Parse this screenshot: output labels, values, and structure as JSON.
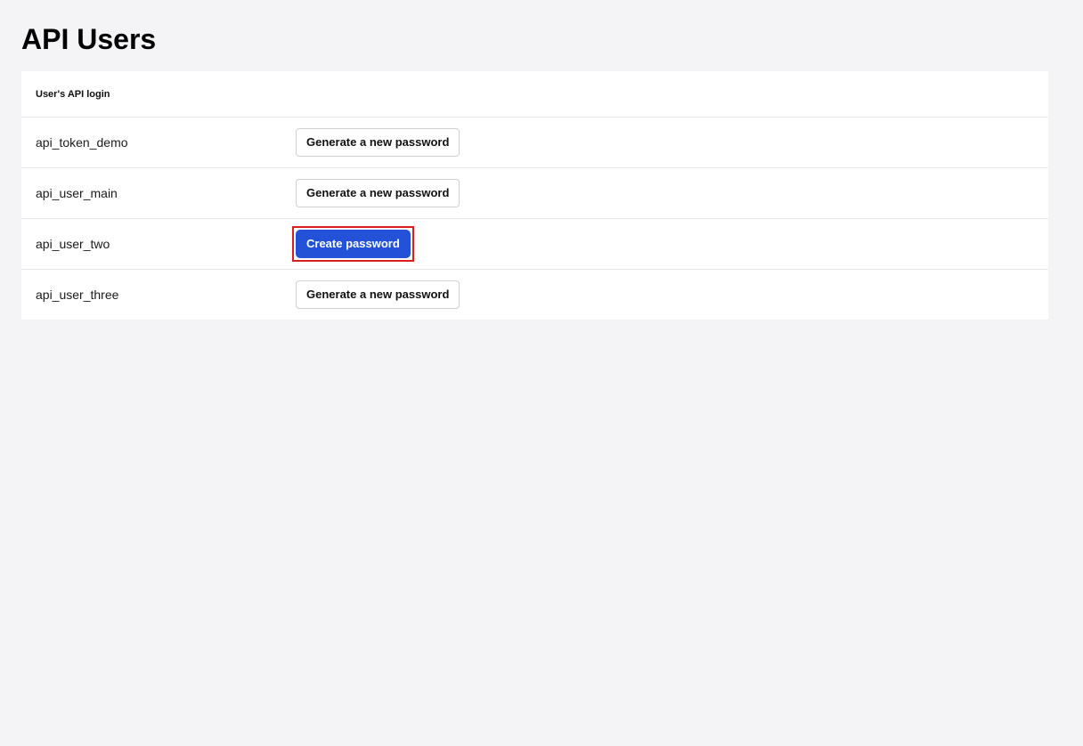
{
  "page": {
    "title": "API Users"
  },
  "table": {
    "header": {
      "login_label": "User's API login"
    },
    "rows": [
      {
        "login": "api_token_demo",
        "action_label": "Generate a new password",
        "action_kind": "secondary"
      },
      {
        "login": "api_user_main",
        "action_label": "Generate a new password",
        "action_kind": "secondary"
      },
      {
        "login": "api_user_two",
        "action_label": "Create password",
        "action_kind": "primary",
        "highlighted": true
      },
      {
        "login": "api_user_three",
        "action_label": "Generate a new password",
        "action_kind": "secondary"
      }
    ]
  },
  "colors": {
    "background": "#f4f4f6",
    "primary_button": "#2352d8",
    "highlight_outline": "#d81e1e"
  }
}
